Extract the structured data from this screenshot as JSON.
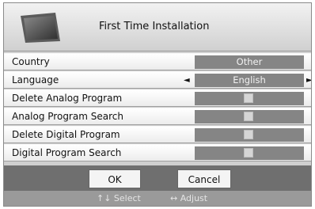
{
  "header": {
    "title": "First Time Installation",
    "icon": "tv-icon"
  },
  "rows": [
    {
      "label": "Country",
      "value": "Other"
    },
    {
      "label": "Language",
      "value": "English",
      "left_arrow": "◄",
      "right_arrow": "►"
    },
    {
      "label": "Delete Analog Program"
    },
    {
      "label": "Analog Program Search"
    },
    {
      "label": "Delete Digital Program"
    },
    {
      "label": "Digital Program Search"
    }
  ],
  "buttons": {
    "ok": "OK",
    "cancel": "Cancel"
  },
  "footer": {
    "select": "↑↓  Select",
    "adjust": "↔  Adjust"
  },
  "colors": {
    "panel": "#cfcfcf",
    "value_box": "#858585",
    "button_area": "#6f6f6f",
    "footer": "#9a9a9a"
  }
}
